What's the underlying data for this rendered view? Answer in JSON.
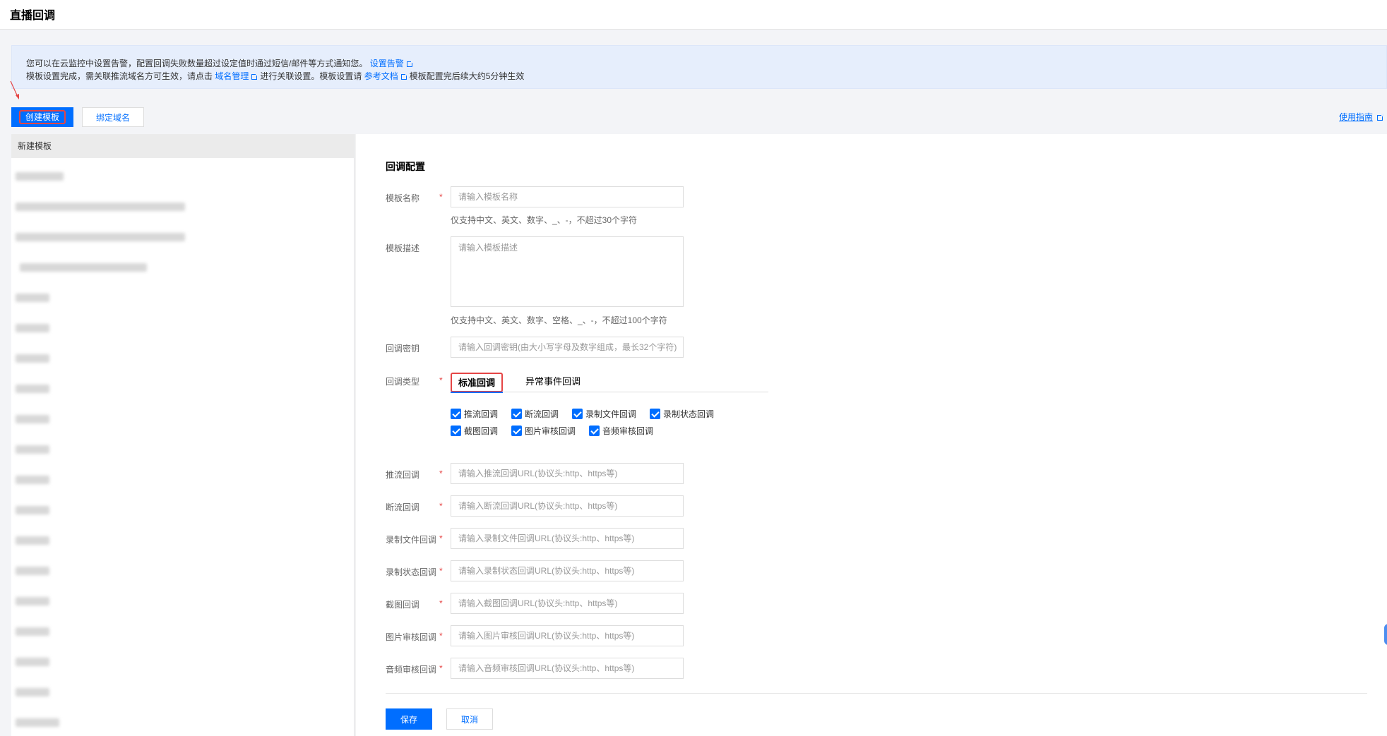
{
  "page": {
    "title": "直播回调"
  },
  "notice": {
    "line1_text": "您可以在云监控中设置告警，配置回调失败数量超过设定值时通过短信/邮件等方式通知您。",
    "line1_link": "设置告警",
    "line2_text_a": "模板设置完成，需关联推流域名方可生效，请点击",
    "line2_link_a": "域名管理",
    "line2_text_b": "进行关联设置。模板设置请",
    "line2_link_b": "参考文档",
    "line2_text_c": "模板配置完后续大约5分钟生效"
  },
  "toolbar": {
    "create_label": "创建模板",
    "bind_label": "绑定域名",
    "guide_label": "使用指南"
  },
  "list": {
    "header": "新建模板"
  },
  "form": {
    "section_title": "回调配置",
    "name": {
      "label": "模板名称",
      "placeholder": "请输入模板名称",
      "hint": "仅支持中文、英文、数字、_、-，不超过30个字符"
    },
    "desc": {
      "label": "模板描述",
      "placeholder": "请输入模板描述",
      "hint": "仅支持中文、英文、数字、空格、_、-，不超过100个字符"
    },
    "key": {
      "label": "回调密钥",
      "placeholder": "请输入回调密钥(由大小写字母及数字组成，最长32个字符)"
    },
    "type": {
      "label": "回调类型",
      "tabs": [
        "标准回调",
        "异常事件回调"
      ],
      "checkboxes": [
        "推流回调",
        "断流回调",
        "录制文件回调",
        "录制状态回调",
        "截图回调",
        "图片审核回调",
        "音频审核回调"
      ]
    },
    "urls": [
      {
        "label": "推流回调",
        "placeholder": "请输入推流回调URL(协议头:http、https等)"
      },
      {
        "label": "断流回调",
        "placeholder": "请输入断流回调URL(协议头:http、https等)"
      },
      {
        "label": "录制文件回调",
        "placeholder": "请输入录制文件回调URL(协议头:http、https等)"
      },
      {
        "label": "录制状态回调",
        "placeholder": "请输入录制状态回调URL(协议头:http、https等)"
      },
      {
        "label": "截图回调",
        "placeholder": "请输入截图回调URL(协议头:http、https等)"
      },
      {
        "label": "图片审核回调",
        "placeholder": "请输入图片审核回调URL(协议头:http、https等)"
      },
      {
        "label": "音频审核回调",
        "placeholder": "请输入音频审核回调URL(协议头:http、https等)"
      }
    ],
    "required_mark": "*",
    "save_label": "保存",
    "cancel_label": "取消"
  },
  "colors": {
    "primary": "#006eff",
    "highlight": "#e54545",
    "notice_bg": "#e6eefc"
  }
}
